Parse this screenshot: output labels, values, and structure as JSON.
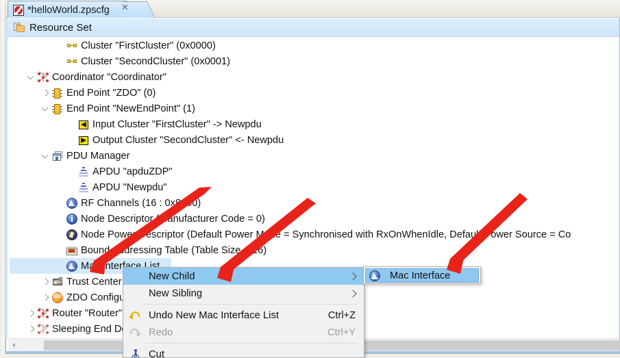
{
  "window": {
    "tab": {
      "title": "*helloWorld.zpscfg",
      "icon": "zpscfg-file-icon",
      "close_label": "✕"
    }
  },
  "resource_header": {
    "label": "Resource Set",
    "icon": "resource-set-icon"
  },
  "tree": {
    "rows": [
      {
        "label": "Cluster \"FirstCluster\" (0x0000)",
        "icon": "cluster-icon",
        "indent": 86,
        "arrow": "none",
        "selected": false
      },
      {
        "label": "Cluster \"SecondCluster\" (0x0001)",
        "icon": "cluster-icon",
        "indent": 86,
        "arrow": "none",
        "selected": false
      },
      {
        "label": "Coordinator \"Coordinator\"",
        "icon": "node-icon",
        "indent": 44,
        "arrow": "down",
        "selected": false
      },
      {
        "label": "End Point \"ZDO\" (0)",
        "icon": "endpoint-icon",
        "indent": 65,
        "arrow": "right",
        "selected": false
      },
      {
        "label": "End Point \"NewEndPoint\" (1)",
        "icon": "endpoint-icon",
        "indent": 65,
        "arrow": "down",
        "selected": false
      },
      {
        "label": "Input Cluster \"FirstCluster\" -> Newpdu",
        "icon": "input-cluster-icon",
        "indent": 103,
        "arrow": "none",
        "selected": false
      },
      {
        "label": "Output Cluster \"SecondCluster\" <- Newpdu",
        "icon": "output-cluster-icon",
        "indent": 103,
        "arrow": "none",
        "selected": false
      },
      {
        "label": "PDU Manager",
        "icon": "pdu-manager-icon",
        "indent": 65,
        "arrow": "down",
        "selected": false
      },
      {
        "label": "APDU \"apduZDP\"",
        "icon": "apdu-icon",
        "indent": 103,
        "arrow": "none",
        "selected": false
      },
      {
        "label": "APDU \"Newpdu\"",
        "icon": "apdu-icon",
        "indent": 103,
        "arrow": "none",
        "selected": false
      },
      {
        "label": "RF Channels (16 : 0x8000)",
        "icon": "rf-channels-icon",
        "indent": 86,
        "arrow": "none",
        "selected": false
      },
      {
        "label": "Node Descriptor (Manufacturer Code = 0)",
        "icon": "node-descriptor-icon",
        "indent": 86,
        "arrow": "none",
        "selected": false
      },
      {
        "label": "Node Power Descriptor (Default Power Mode = Synchronised with RxOnWhenIdle, Default Power Source = Co",
        "icon": "node-power-descriptor-icon",
        "indent": 86,
        "arrow": "none",
        "selected": false
      },
      {
        "label": "Bound Addressing Table (Table Size = 16)",
        "icon": "binding-table-icon",
        "indent": 86,
        "arrow": "none",
        "selected": false
      },
      {
        "label": "Mac Interface List",
        "icon": "mac-interface-list-icon",
        "indent": 86,
        "arrow": "none",
        "selected": true
      },
      {
        "label": "Trust Center \"Trust Center\"",
        "icon": "trust-center-icon",
        "indent": 65,
        "arrow": "right",
        "selected": false
      },
      {
        "label": "ZDO Configuration",
        "icon": "zdo-config-icon",
        "indent": 65,
        "arrow": "right",
        "selected": false
      },
      {
        "label": "Router \"Router\"",
        "icon": "router-node-icon",
        "indent": 44,
        "arrow": "right",
        "selected": false
      },
      {
        "label": "Sleeping End Device \"SleepingEndDevice\"",
        "icon": "sleeping-node-icon",
        "indent": 44,
        "arrow": "right",
        "selected": false
      }
    ]
  },
  "context_menu": {
    "items": [
      {
        "label": "New Child",
        "icon": null,
        "accel": "",
        "submenu": true,
        "highlighted": true,
        "disabled": false
      },
      {
        "label": "New Sibling",
        "icon": null,
        "accel": "",
        "submenu": true,
        "highlighted": false,
        "disabled": false
      },
      {
        "separator": true
      },
      {
        "label": "Undo New Mac Interface List",
        "icon": "undo-icon",
        "accel": "Ctrl+Z",
        "submenu": false,
        "highlighted": false,
        "disabled": false
      },
      {
        "label": "Redo",
        "icon": "redo-icon",
        "accel": "Ctrl+Y",
        "submenu": false,
        "highlighted": false,
        "disabled": true
      },
      {
        "separator": true
      },
      {
        "label": "Cut",
        "icon": "cut-icon",
        "accel": "",
        "submenu": false,
        "highlighted": false,
        "disabled": false
      }
    ]
  },
  "submenu": {
    "items": [
      {
        "label": "Mac Interface",
        "icon": "mac-interface-icon",
        "highlighted": true
      }
    ]
  },
  "scrollbar": {
    "left_arrow": "‹"
  },
  "colors": {
    "selection_blue": "#d3e9fb",
    "menu_highlight": "#8fc9f0",
    "tab_blue": "#cbe6fa",
    "annotation_red": "#e8231a"
  }
}
